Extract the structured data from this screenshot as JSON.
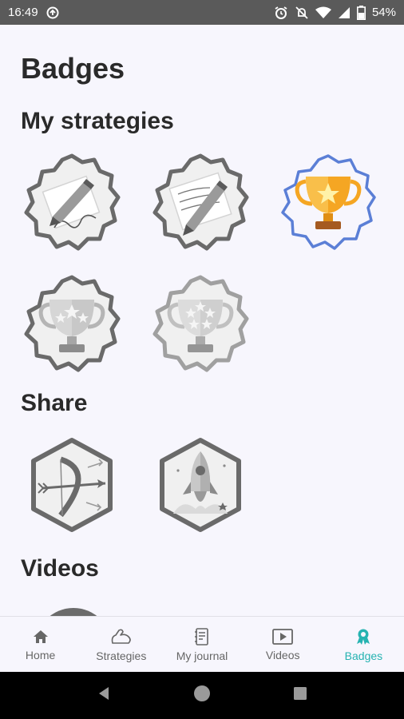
{
  "status_bar": {
    "time": "16:49",
    "battery": "54%"
  },
  "page": {
    "title": "Badges"
  },
  "sections": {
    "strategies": "My strategies",
    "share": "Share",
    "videos": "Videos"
  },
  "badges": {
    "strategies": [
      {
        "icon": "pencil-sketch-icon",
        "earned": false
      },
      {
        "icon": "pencil-write-icon",
        "earned": false
      },
      {
        "icon": "trophy-one-star-icon",
        "earned": true
      },
      {
        "icon": "trophy-three-stars-icon",
        "earned": false
      },
      {
        "icon": "trophy-five-stars-icon",
        "earned": false
      }
    ],
    "share": [
      {
        "icon": "bow-arrow-icon",
        "earned": false
      },
      {
        "icon": "rocket-icon",
        "earned": false
      }
    ]
  },
  "bottom_nav": {
    "items": [
      {
        "label": "Home",
        "icon": "home-icon"
      },
      {
        "label": "Strategies",
        "icon": "strategies-icon"
      },
      {
        "label": "My journal",
        "icon": "journal-icon"
      },
      {
        "label": "Videos",
        "icon": "video-icon"
      },
      {
        "label": "Badges",
        "icon": "badge-icon",
        "active": true
      }
    ]
  },
  "colors": {
    "accent": "#26b3b1",
    "earned_ring": "#5b7fd6",
    "unearned_ring": "#6a6a6a",
    "gold": "#f5a623"
  }
}
